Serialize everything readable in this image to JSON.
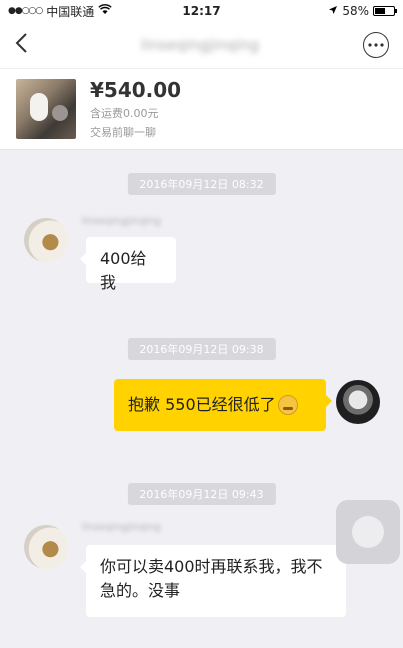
{
  "status_bar": {
    "signal": "●●○○○",
    "carrier": "中国联通",
    "wifi_icon": "wifi-icon",
    "time": "12:17",
    "location_icon": "location-arrow-icon",
    "battery": "58%",
    "battery_level": 0.58
  },
  "nav": {
    "back_icon": "chevron-left-icon",
    "title": "linseqingjinqing",
    "more_icon": "more-dots-icon"
  },
  "product": {
    "price": "¥540.00",
    "shipping": "含运费0.00元",
    "chat_hint": "交易前聊一聊"
  },
  "chat": {
    "messages": [
      {
        "timestamp": "2016年09月12日 08:32",
        "sender_name": "linseqingjinqing",
        "text": "400给我",
        "side": "left"
      },
      {
        "timestamp": "2016年09月12日 09:38",
        "text": "抱歉 550已经很低了",
        "side": "right"
      },
      {
        "timestamp": "2016年09月12日 09:43",
        "sender_name": "linseqingjinqing",
        "text": "你可以卖400时再联系我，我不急的。没事",
        "side": "left"
      }
    ]
  },
  "colors": {
    "background": "#efeff4",
    "outgoing_bubble": "#ffd200",
    "incoming_bubble": "#ffffff",
    "timestamp_bg": "#d7d7dc"
  }
}
